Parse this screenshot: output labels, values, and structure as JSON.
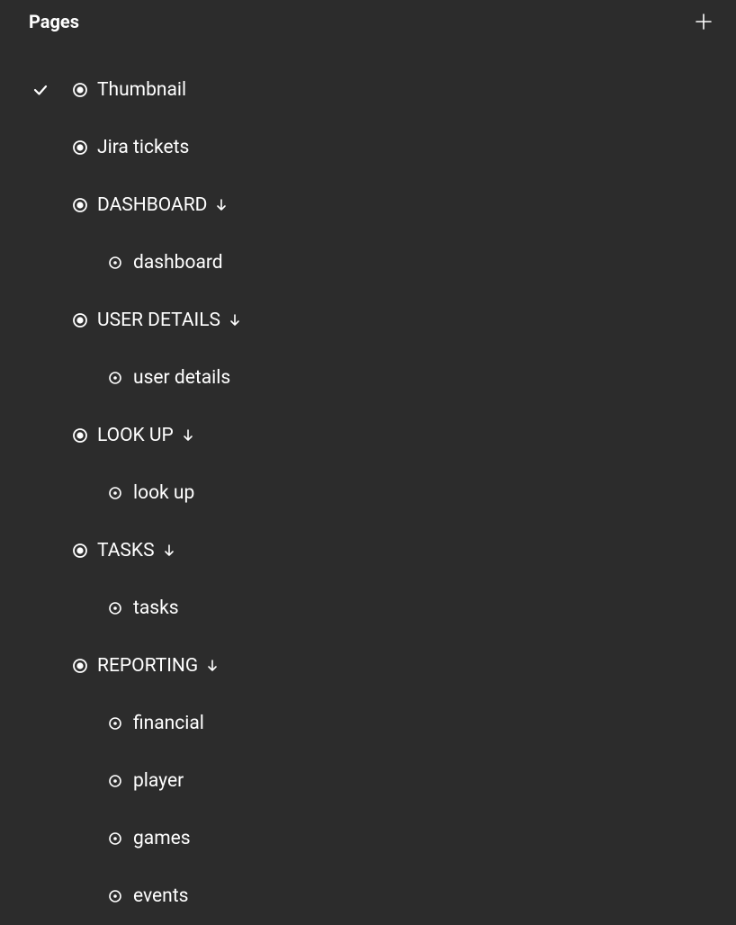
{
  "header": {
    "title": "Pages"
  },
  "rows": [
    {
      "kind": "top",
      "checked": true,
      "label": "Thumbnail",
      "arrow": false
    },
    {
      "kind": "top",
      "checked": false,
      "label": "Jira tickets",
      "arrow": false
    },
    {
      "kind": "top",
      "checked": false,
      "label": "DASHBOARD",
      "arrow": true
    },
    {
      "kind": "child",
      "checked": false,
      "label": "dashboard",
      "arrow": false
    },
    {
      "kind": "top",
      "checked": false,
      "label": "USER DETAILS",
      "arrow": true
    },
    {
      "kind": "child",
      "checked": false,
      "label": "user details",
      "arrow": false
    },
    {
      "kind": "top",
      "checked": false,
      "label": "LOOK UP",
      "arrow": true
    },
    {
      "kind": "child",
      "checked": false,
      "label": "look up",
      "arrow": false
    },
    {
      "kind": "top",
      "checked": false,
      "label": "TASKS",
      "arrow": true
    },
    {
      "kind": "child",
      "checked": false,
      "label": "tasks",
      "arrow": false
    },
    {
      "kind": "top",
      "checked": false,
      "label": "REPORTING",
      "arrow": true
    },
    {
      "kind": "child",
      "checked": false,
      "label": "financial",
      "arrow": false
    },
    {
      "kind": "child",
      "checked": false,
      "label": "player",
      "arrow": false
    },
    {
      "kind": "child",
      "checked": false,
      "label": "games",
      "arrow": false
    },
    {
      "kind": "child",
      "checked": false,
      "label": "events",
      "arrow": false
    }
  ]
}
